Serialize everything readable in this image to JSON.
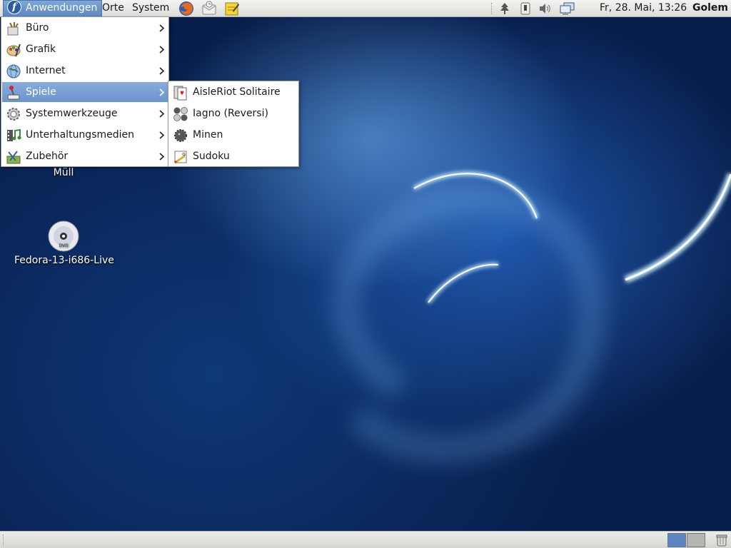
{
  "top_panel": {
    "menus": {
      "applications": "Anwendungen",
      "places": "Orte",
      "system": "System"
    },
    "launchers": [
      "firefox-icon",
      "evolution-mail-icon",
      "notes-icon"
    ],
    "tray_icons": [
      "network-tree-icon",
      "power-icon",
      "volume-icon",
      "network-manager-icon"
    ],
    "clock": "Fr, 28. Mai, 13:26",
    "user": "Golem"
  },
  "applications_menu": {
    "items": [
      {
        "label": "Büro",
        "icon": "office-icon"
      },
      {
        "label": "Grafik",
        "icon": "graphics-icon"
      },
      {
        "label": "Internet",
        "icon": "internet-globe-icon"
      },
      {
        "label": "Spiele",
        "icon": "games-joystick-icon",
        "selected": true
      },
      {
        "label": "Systemwerkzeuge",
        "icon": "system-tools-gear-icon"
      },
      {
        "label": "Unterhaltungsmedien",
        "icon": "multimedia-icon"
      },
      {
        "label": "Zubehör",
        "icon": "accessories-icon"
      }
    ]
  },
  "games_submenu": {
    "items": [
      {
        "label": "AisleRiot Solitaire",
        "icon": "solitaire-cards-icon"
      },
      {
        "label": "Iagno (Reversi)",
        "icon": "reversi-icon"
      },
      {
        "label": "Minen",
        "icon": "mines-icon"
      },
      {
        "label": "Sudoku",
        "icon": "sudoku-icon"
      }
    ]
  },
  "desktop_icons": [
    {
      "label": "Müll",
      "icon": "trash-icon"
    },
    {
      "label": "Fedora-13-i686-Live",
      "icon": "dvd-disc-icon"
    }
  ],
  "colors": {
    "selection": "#6a95cf",
    "desktop": "#0d2a5c"
  }
}
